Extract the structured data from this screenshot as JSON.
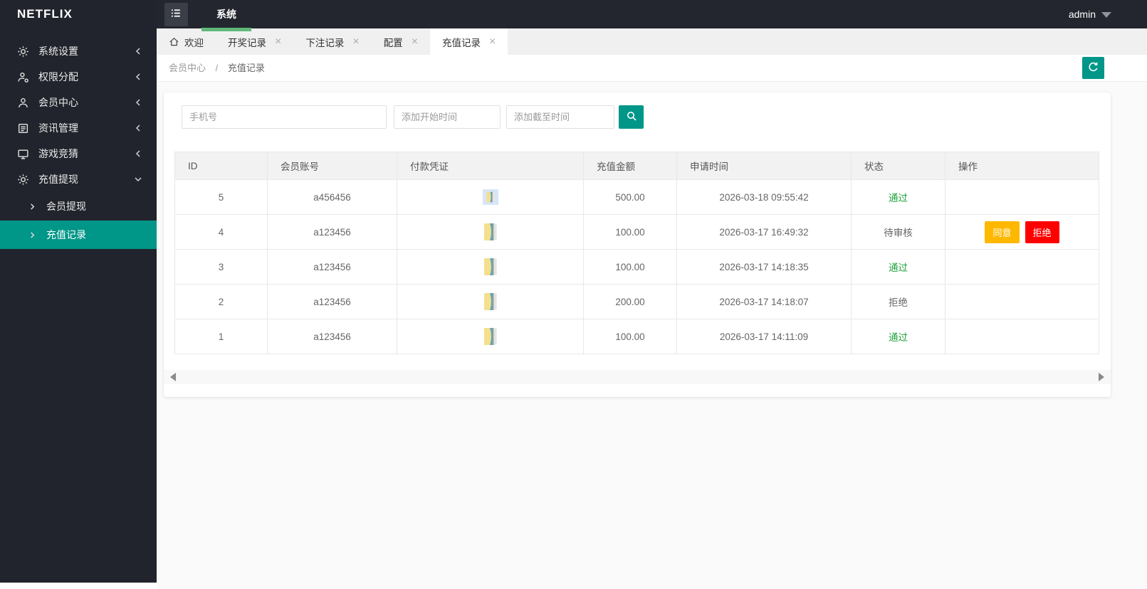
{
  "colors": {
    "teal": "#009688",
    "accent_green": "#5FB878",
    "status_green": "#1FA23C",
    "agree_orange": "#FFB800",
    "reject_red": "#FF0000"
  },
  "brand": {
    "logo": "NETFLIX"
  },
  "topbar": {
    "nav_item": "系统",
    "user": "admin"
  },
  "sidebar": {
    "items": [
      {
        "label": "系统设置",
        "icon": "gear-icon",
        "state": "collapsed"
      },
      {
        "label": "权限分配",
        "icon": "user-gear-icon",
        "state": "collapsed"
      },
      {
        "label": "会员中心",
        "icon": "user-icon",
        "state": "collapsed"
      },
      {
        "label": "资讯管理",
        "icon": "document-icon",
        "state": "collapsed"
      },
      {
        "label": "游戏竞猜",
        "icon": "monitor-icon",
        "state": "collapsed"
      },
      {
        "label": "充值提现",
        "icon": "gear-icon",
        "state": "expanded",
        "children": [
          {
            "label": "会员提现",
            "active": false
          },
          {
            "label": "充值记录",
            "active": true
          }
        ]
      }
    ]
  },
  "tabs": [
    {
      "label": "欢迎",
      "icon": "home-icon",
      "closable": false,
      "active": false
    },
    {
      "label": "开奖记录",
      "closable": true,
      "active": false
    },
    {
      "label": "下注记录",
      "closable": true,
      "active": false
    },
    {
      "label": "配置",
      "closable": true,
      "active": false
    },
    {
      "label": "充值记录",
      "closable": true,
      "active": true
    }
  ],
  "breadcrumb": {
    "items": [
      "会员中心",
      "充值记录"
    ],
    "separator": "/"
  },
  "search": {
    "phone_placeholder": "手机号",
    "start_time_placeholder": "添加开始时间",
    "end_time_placeholder": "添加截至时间"
  },
  "table": {
    "columns": [
      "ID",
      "会员账号",
      "付款凭证",
      "充值金额",
      "申请时间",
      "状态",
      "操作"
    ],
    "rows": [
      {
        "id": "5",
        "account": "a456456",
        "voucher": "image-thumbnail-selected",
        "amount": "500.00",
        "time": "2026-03-18 09:55:42",
        "status": "通过",
        "status_color": "green",
        "actions": []
      },
      {
        "id": "4",
        "account": "a123456",
        "voucher": "image-thumbnail",
        "amount": "100.00",
        "time": "2026-03-17 16:49:32",
        "status": "待审核",
        "status_color": "grey",
        "actions": [
          {
            "label": "同意",
            "color_key": "agree_orange"
          },
          {
            "label": "拒绝",
            "color_key": "reject_red"
          }
        ]
      },
      {
        "id": "3",
        "account": "a123456",
        "voucher": "image-thumbnail",
        "amount": "100.00",
        "time": "2026-03-17 14:18:35",
        "status": "通过",
        "status_color": "green",
        "actions": []
      },
      {
        "id": "2",
        "account": "a123456",
        "voucher": "image-thumbnail",
        "amount": "200.00",
        "time": "2026-03-17 14:18:07",
        "status": "拒绝",
        "status_color": "grey",
        "actions": []
      },
      {
        "id": "1",
        "account": "a123456",
        "voucher": "image-thumbnail",
        "amount": "100.00",
        "time": "2026-03-17 14:11:09",
        "status": "通过",
        "status_color": "green",
        "actions": []
      }
    ]
  }
}
